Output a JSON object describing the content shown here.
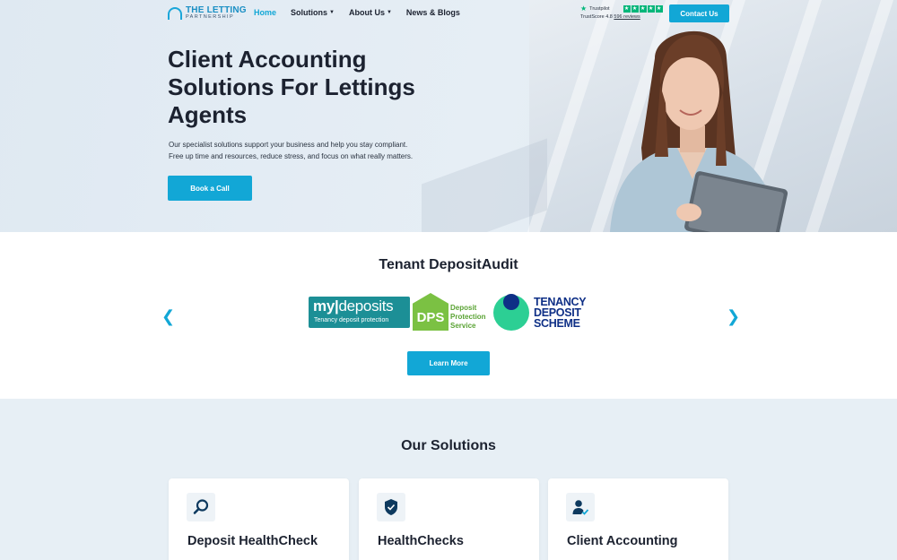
{
  "brand": {
    "line1": "THE LETTING",
    "line2": "PARTNERSHIP"
  },
  "nav": {
    "items": [
      {
        "label": "Home",
        "active": true,
        "dropdown": false
      },
      {
        "label": "Solutions",
        "active": false,
        "dropdown": true
      },
      {
        "label": "About Us",
        "active": false,
        "dropdown": true
      },
      {
        "label": "News & Blogs",
        "active": false,
        "dropdown": false
      }
    ],
    "contact_label": "Contact Us"
  },
  "trustpilot": {
    "name": "Trustpilot",
    "score_label": "TrustScore 4.8",
    "reviews": "596 reviews",
    "stars": 5
  },
  "hero": {
    "title": "Client Accounting Solutions For Lettings Agents",
    "subtitle_line1": "Our specialist solutions support your business and help you stay compliant.",
    "subtitle_line2": "Free up time and resources, reduce stress, and focus on what really matters.",
    "cta": "Book a Call"
  },
  "audit": {
    "title": "Tenant DepositAudit",
    "logos": {
      "mydeposits_my": "my",
      "mydeposits_dep": "deposits",
      "mydeposits_tag": "Tenancy deposit protection",
      "dps_mark": "DPS",
      "dps_line1": "Deposit",
      "dps_line2": "Protection",
      "dps_line3": "Service",
      "tds_line1": "TENANCY",
      "tds_line2": "DEPOSIT",
      "tds_line3": "SCHEME"
    },
    "cta": "Learn More"
  },
  "solutions": {
    "title": "Our Solutions",
    "cards": [
      {
        "title": "Deposit HealthCheck",
        "icon": "magnifier-icon"
      },
      {
        "title": "HealthChecks",
        "icon": "shield-check-icon"
      },
      {
        "title": "Client Accounting",
        "icon": "user-check-icon"
      }
    ]
  },
  "colors": {
    "accent": "#12a7d6",
    "trustpilot": "#00b67a",
    "mydeposits": "#1c8f96",
    "dps": "#7bc143",
    "tds_blue": "#0e2f86",
    "tds_green": "#2ccf94"
  }
}
